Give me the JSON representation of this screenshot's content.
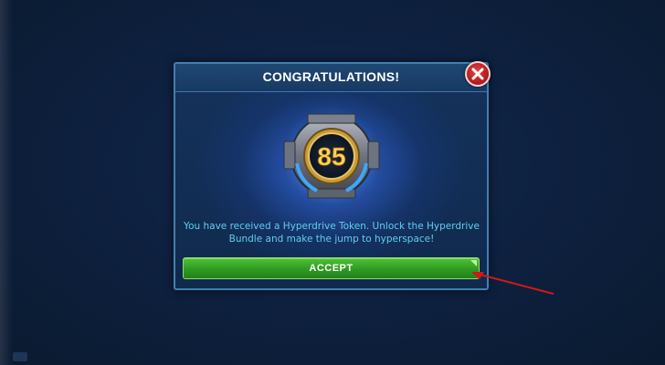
{
  "dialog": {
    "title": "CONGRATULATIONS!",
    "message": "You have received a Hyperdrive Token. Unlock the Hyperdrive Bundle and make the jump to hyperspace!",
    "token_value": "85",
    "accept_label": "ACCEPT"
  },
  "icons": {
    "close": "close-icon",
    "token": "hyperdrive-token-icon",
    "annotation": "red-arrow-annotation"
  },
  "colors": {
    "background": "#0c1d33",
    "dialog_border": "#3f7fb8",
    "title_text": "#ffffff",
    "message_text": "#5fd0f0",
    "accept_button": "#2f9a22",
    "close_button": "#b81d1d",
    "token_number": "#ffd55a",
    "annotation_arrow": "#d01818"
  }
}
